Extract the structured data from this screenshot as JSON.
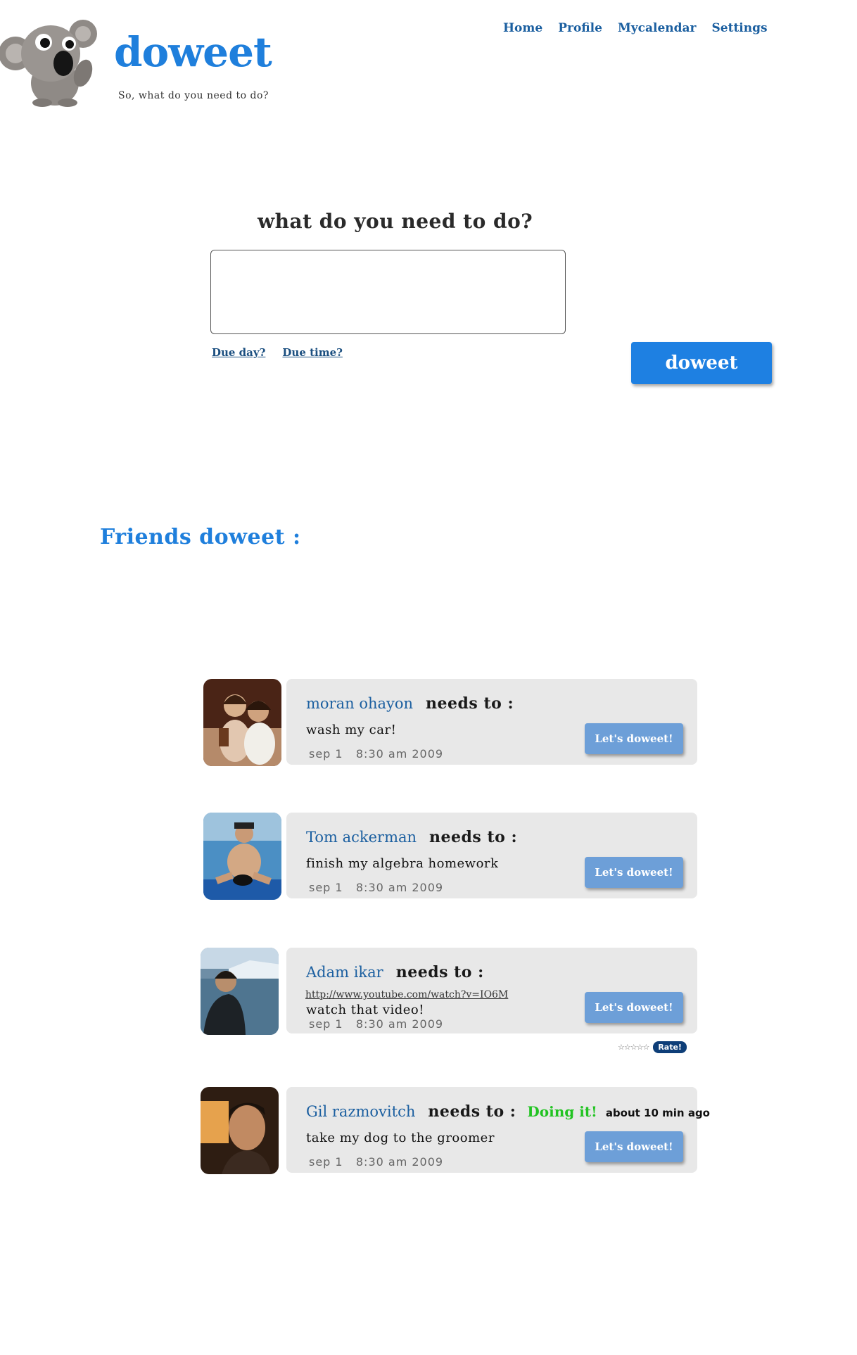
{
  "header": {
    "logo_text": "doweet",
    "tagline": "So, what do you need to do?"
  },
  "nav": {
    "items": [
      {
        "label": "Home"
      },
      {
        "label": "Profile"
      },
      {
        "label": "Mycalendar"
      },
      {
        "label": "Settings"
      }
    ]
  },
  "compose": {
    "title": "what do you need to do?",
    "input_value": "",
    "due_day_label": "Due day?",
    "due_time_label": "Due time?",
    "submit_label": "doweet"
  },
  "friends": {
    "heading": "Friends doweet :",
    "items": [
      {
        "name": "moran ohayon",
        "needs_to": "needs to :",
        "task": "wash my car!",
        "date": "sep 1",
        "time": "8:30 am 2009",
        "button": "Let's doweet!"
      },
      {
        "name": "Tom ackerman",
        "needs_to": "needs to :",
        "task": "finish my algebra homework",
        "date": "sep 1",
        "time": "8:30 am 2009",
        "button": "Let's doweet!"
      },
      {
        "name": "Adam ikar",
        "needs_to": "needs to :",
        "url": "http://www.youtube.com/watch?v=IO6M",
        "task": "watch that video!",
        "date": "sep 1",
        "time": "8:30 am 2009",
        "button": "Let's doweet!",
        "rate_label": "Rate!",
        "stars": "☆☆☆☆☆"
      },
      {
        "name": "Gil razmovitch",
        "needs_to": "needs to :",
        "status": "Doing it!",
        "status_time": "about 10 min ago",
        "task": "take my dog to the groomer",
        "date": "sep 1",
        "time": "8:30 am 2009",
        "button": "Let's doweet!"
      }
    ]
  },
  "colors": {
    "brand_blue": "#1f7fdc",
    "link_blue": "#1b5fa0",
    "card_bg": "#e8e8e8",
    "button_light_blue": "#6d9fd8",
    "status_green": "#22c322"
  }
}
